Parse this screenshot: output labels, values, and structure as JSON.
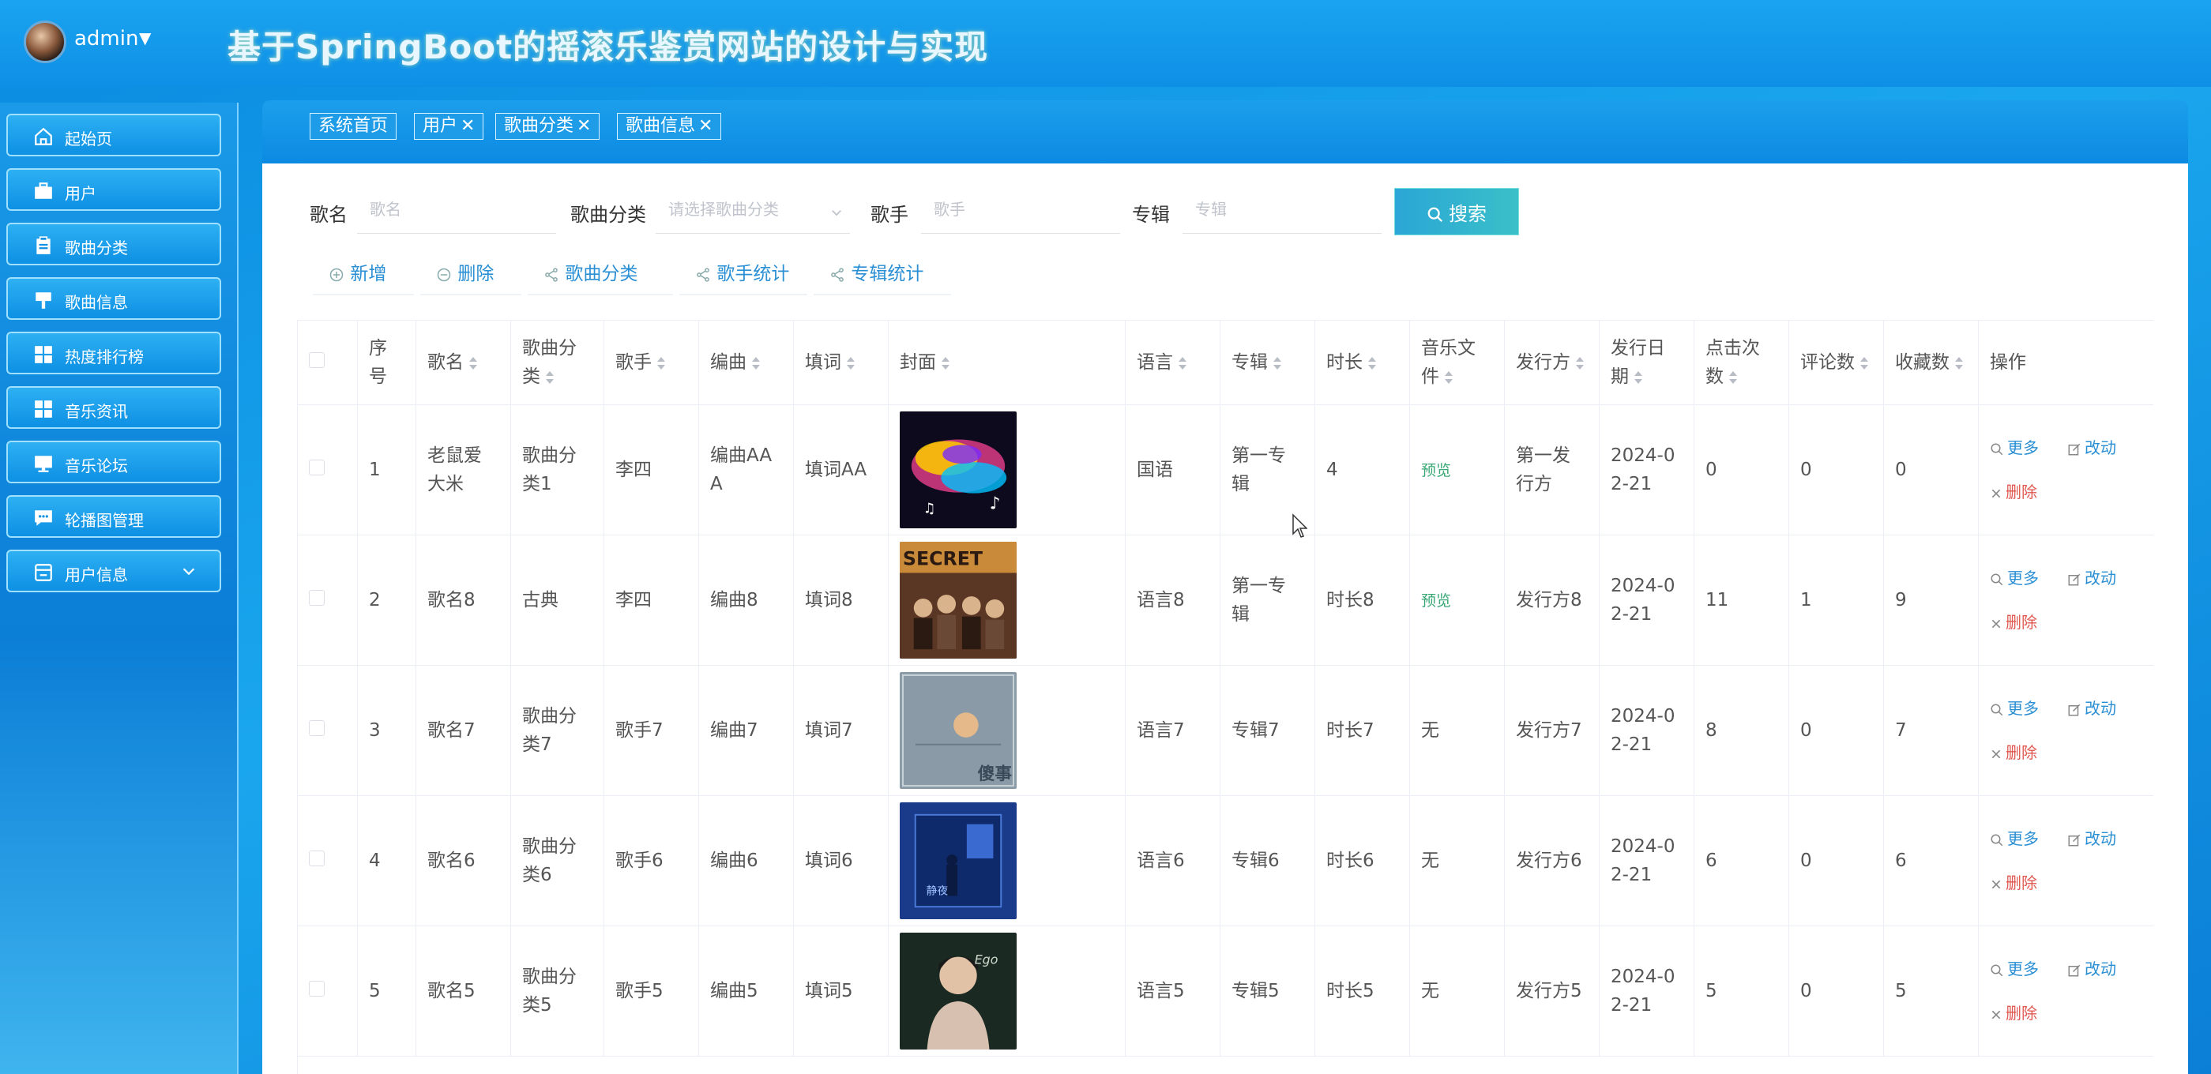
{
  "header": {
    "user_name": "admin",
    "site_title": "基于SpringBoot的摇滚乐鉴赏网站的设计与实现"
  },
  "sidebar": {
    "items": [
      {
        "label": "起始页",
        "icon": "home-icon"
      },
      {
        "label": "用户",
        "icon": "briefcase-icon"
      },
      {
        "label": "歌曲分类",
        "icon": "clipboard-icon"
      },
      {
        "label": "歌曲信息",
        "icon": "pushpin-icon"
      },
      {
        "label": "热度排行榜",
        "icon": "grid-icon"
      },
      {
        "label": "音乐资讯",
        "icon": "grid-icon"
      },
      {
        "label": "音乐论坛",
        "icon": "monitor-icon"
      },
      {
        "label": "轮播图管理",
        "icon": "chat-icon"
      },
      {
        "label": "用户信息",
        "icon": "window-icon"
      }
    ]
  },
  "tabs": [
    {
      "label": "系统首页",
      "closable": false
    },
    {
      "label": "用户",
      "closable": true
    },
    {
      "label": "歌曲分类",
      "closable": true
    },
    {
      "label": "歌曲信息",
      "closable": true
    }
  ],
  "filters": {
    "song_name": {
      "label": "歌名",
      "placeholder": "歌名",
      "value": ""
    },
    "category": {
      "label": "歌曲分类",
      "placeholder": "请选择歌曲分类",
      "value": ""
    },
    "singer": {
      "label": "歌手",
      "placeholder": "歌手",
      "value": ""
    },
    "album": {
      "label": "专辑",
      "placeholder": "专辑",
      "value": ""
    },
    "search_label": "搜索"
  },
  "actions": {
    "add": "新增",
    "delete": "删除",
    "category": "歌曲分类",
    "singer_stats": "歌手统计",
    "album_stats": "专辑统计"
  },
  "table": {
    "columns": [
      "序号",
      "歌名",
      "歌曲分类",
      "歌手",
      "编曲",
      "填词",
      "封面",
      "语言",
      "专辑",
      "时长",
      "音乐文件",
      "发行方",
      "发行日期",
      "点击次数",
      "评论数",
      "收藏数",
      "操作"
    ],
    "ops": {
      "more": "更多",
      "edit": "改动",
      "delete": "删除"
    },
    "rows": [
      {
        "index": "1",
        "name": "老鼠爱大米",
        "category": "歌曲分类1",
        "singer": "李四",
        "arranger": "编曲AAA",
        "lyricist": "填词AA",
        "cover": "cover-colorful-notes",
        "language": "国语",
        "album": "第一专辑",
        "duration": "4",
        "file": "预览",
        "publisher": "第一发行方",
        "date": "2024-02-21",
        "clicks": "0",
        "comments": "0",
        "favorites": "0"
      },
      {
        "index": "2",
        "name": "歌名8",
        "category": "古典",
        "singer": "李四",
        "arranger": "编曲8",
        "lyricist": "填词8",
        "cover": "cover-band-stage",
        "language": "语言8",
        "album": "第一专辑",
        "duration": "时长8",
        "file": "预览",
        "publisher": "发行方8",
        "date": "2024-02-21",
        "clicks": "11",
        "comments": "1",
        "favorites": "9"
      },
      {
        "index": "3",
        "name": "歌名7",
        "category": "歌曲分类7",
        "singer": "歌手7",
        "arranger": "编曲7",
        "lyricist": "填词7",
        "cover": "cover-moon-poster",
        "language": "语言7",
        "album": "专辑7",
        "duration": "时长7",
        "file": "无",
        "publisher": "发行方7",
        "date": "2024-02-21",
        "clicks": "8",
        "comments": "0",
        "favorites": "7"
      },
      {
        "index": "4",
        "name": "歌名6",
        "category": "歌曲分类6",
        "singer": "歌手6",
        "arranger": "编曲6",
        "lyricist": "填词6",
        "cover": "cover-blue-room",
        "language": "语言6",
        "album": "专辑6",
        "duration": "时长6",
        "file": "无",
        "publisher": "发行方6",
        "date": "2024-02-21",
        "clicks": "6",
        "comments": "0",
        "favorites": "6"
      },
      {
        "index": "5",
        "name": "歌名5",
        "category": "歌曲分类5",
        "singer": "歌手5",
        "arranger": "编曲5",
        "lyricist": "填词5",
        "cover": "cover-portrait",
        "language": "语言5",
        "album": "专辑5",
        "duration": "时长5",
        "file": "无",
        "publisher": "发行方5",
        "date": "2024-02-21",
        "clicks": "5",
        "comments": "0",
        "favorites": "5"
      }
    ]
  },
  "colors": {
    "accent": "#1e9ce8",
    "link": "#2b8fd4",
    "danger": "#e0574f",
    "preview": "#3aa876"
  }
}
